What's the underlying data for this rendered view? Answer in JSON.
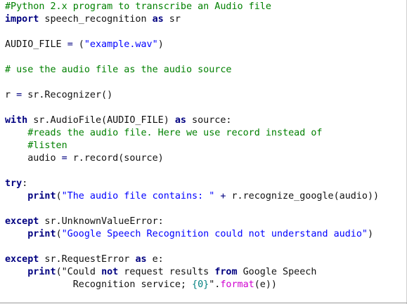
{
  "code": {
    "lines": [
      "#Python 2.x program to transcribe an Audio file",
      "import speech_recognition as sr",
      "",
      "AUDIO_FILE = (\"example.wav\")",
      "",
      "# use the audio file as the audio source",
      "",
      "r = sr.Recognizer()",
      "",
      "with sr.AudioFile(AUDIO_FILE) as source:",
      "    #reads the audio file. Here we use record instead of",
      "    #listen",
      "    audio = r.record(source)",
      "",
      "try:",
      "    print(\"The audio file contains: \" + r.recognize_google(audio))",
      "",
      "except sr.UnknownValueError:",
      "    print(\"Google Speech Recognition could not understand audio\")",
      "",
      "except sr.RequestError as e:",
      "    print(\"Could not request results from Google Speech",
      "            Recognition service; {0}\".format(e))"
    ],
    "colors": {
      "comment": "#008000",
      "keyword": "#000080",
      "string": "#0000ff",
      "number": "#008080",
      "method": "#d000d0",
      "text": "#111111"
    }
  }
}
